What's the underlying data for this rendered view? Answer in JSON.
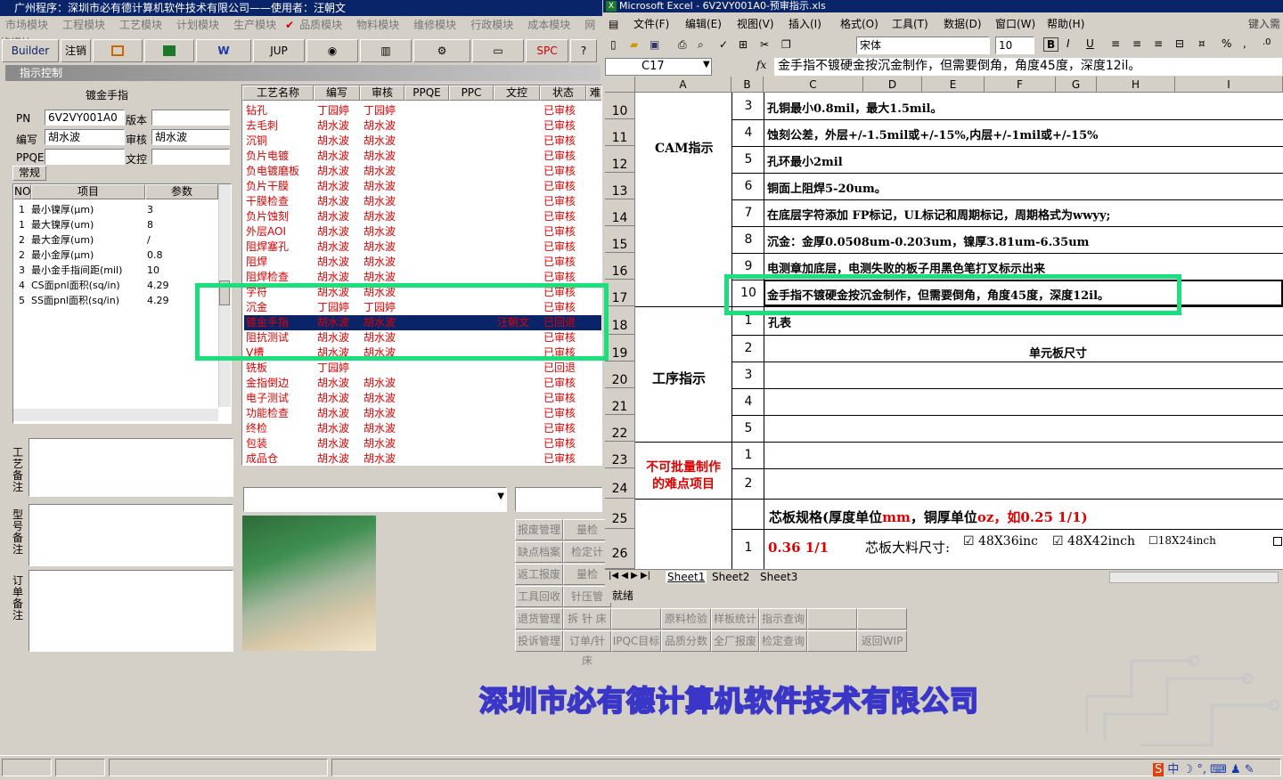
{
  "left_app": {
    "title": "广州程序：深圳市必有德计算机软件技术有限公司——使用者：汪朝文",
    "menu": [
      "市场模块",
      "工程模块",
      "工艺模块",
      "计划模块",
      "生产模块",
      "品质模块",
      "物料模块",
      "维修模块",
      "行政模块",
      "成本模块",
      "网络模块"
    ],
    "toolbar": [
      "Builder",
      "注销",
      "",
      "",
      "",
      "JUP",
      "",
      "",
      "",
      "",
      "SPC",
      ""
    ],
    "panel_title": "指示控制",
    "section": "镀金手指",
    "pn_label": "PN",
    "pn_value": "6V2VY001A0",
    "version_label": "版本",
    "version_value": "",
    "editor_label": "编写",
    "editor_value": "胡水波",
    "reviewer_label": "审核",
    "reviewer_value": "胡水波",
    "ppqe_label": "PPQE",
    "ppqe_value": "",
    "wenkong_label": "文控",
    "wenkong_value": "",
    "tab": "常规",
    "param_headers": [
      "NO",
      "项目",
      "参数"
    ],
    "params": [
      {
        "no": "1",
        "item": "最小镍厚(μm)",
        "val": "3"
      },
      {
        "no": "1",
        "item": "最大镍厚(um)",
        "val": "8"
      },
      {
        "no": "2",
        "item": "最大金厚(um)",
        "val": "/"
      },
      {
        "no": "2",
        "item": "最小金厚(μm)",
        "val": "0.8"
      },
      {
        "no": "3",
        "item": "最小金手指间距(mil)",
        "val": "10"
      },
      {
        "no": "4",
        "item": "CS面pnl面积(sq/in)",
        "val": "4.29"
      },
      {
        "no": "5",
        "item": "SS面pnl面积(sq/in)",
        "val": "4.29"
      }
    ],
    "process_headers": [
      "工艺名称",
      "编写",
      "审核",
      "PPQE",
      "PPC",
      "文控",
      "状态",
      "难"
    ],
    "processes": [
      {
        "name": "钻孔",
        "w": "丁园婷",
        "r": "丁园婷",
        "wk": "",
        "s": "已审核"
      },
      {
        "name": "去毛刺",
        "w": "胡水波",
        "r": "胡水波",
        "wk": "",
        "s": "已审核"
      },
      {
        "name": "沉铜",
        "w": "胡水波",
        "r": "胡水波",
        "wk": "",
        "s": "已审核"
      },
      {
        "name": "负片电镀",
        "w": "胡水波",
        "r": "胡水波",
        "wk": "",
        "s": "已审核"
      },
      {
        "name": "负电镀磨板",
        "w": "胡水波",
        "r": "胡水波",
        "wk": "",
        "s": "已审核"
      },
      {
        "name": "负片干膜",
        "w": "胡水波",
        "r": "胡水波",
        "wk": "",
        "s": "已审核"
      },
      {
        "name": "干膜检查",
        "w": "胡水波",
        "r": "胡水波",
        "wk": "",
        "s": "已审核"
      },
      {
        "name": "负片蚀刻",
        "w": "胡水波",
        "r": "胡水波",
        "wk": "",
        "s": "已审核"
      },
      {
        "name": "外层AOI",
        "w": "胡水波",
        "r": "胡水波",
        "wk": "",
        "s": "已审核"
      },
      {
        "name": "阻焊塞孔",
        "w": "胡水波",
        "r": "胡水波",
        "wk": "",
        "s": "已审核"
      },
      {
        "name": "阻焊",
        "w": "胡水波",
        "r": "胡水波",
        "wk": "",
        "s": "已审核"
      },
      {
        "name": "阻焊检查",
        "w": "胡水波",
        "r": "胡水波",
        "wk": "",
        "s": "已审核"
      },
      {
        "name": "字符",
        "w": "胡水波",
        "r": "胡水波",
        "wk": "",
        "s": "已审核"
      },
      {
        "name": "沉金",
        "w": "丁园婷",
        "r": "丁园婷",
        "wk": "",
        "s": "已审核"
      },
      {
        "name": "镀金手指",
        "w": "胡水波",
        "r": "胡水波",
        "wk": "汪朝文",
        "s": "已回退"
      },
      {
        "name": "阻抗测试",
        "w": "胡水波",
        "r": "胡水波",
        "wk": "",
        "s": "已审核"
      },
      {
        "name": "V槽",
        "w": "胡水波",
        "r": "胡水波",
        "wk": "",
        "s": "已审核"
      },
      {
        "name": "铣板",
        "w": "丁园婷",
        "r": "",
        "wk": "",
        "s": "已回退"
      },
      {
        "name": "金指倒边",
        "w": "胡水波",
        "r": "胡水波",
        "wk": "",
        "s": "已审核"
      },
      {
        "name": "电子测试",
        "w": "胡水波",
        "r": "胡水波",
        "wk": "",
        "s": "已审核"
      },
      {
        "name": "功能检查",
        "w": "胡水波",
        "r": "胡水波",
        "wk": "",
        "s": "已审核"
      },
      {
        "name": "终检",
        "w": "胡水波",
        "r": "胡水波",
        "wk": "",
        "s": "已审核"
      },
      {
        "name": "包装",
        "w": "胡水波",
        "r": "胡水波",
        "wk": "",
        "s": "已审核"
      },
      {
        "name": "成品仓",
        "w": "胡水波",
        "r": "胡水波",
        "wk": "",
        "s": "已审核"
      }
    ],
    "side_labels": [
      "工艺备注",
      "型号备注",
      "订单备注"
    ],
    "buttons_col1": [
      "报废管理",
      "缺点档案",
      "返工报废",
      "工具回收",
      "退货管理",
      "投诉管理"
    ],
    "buttons_col2": [
      "量检",
      "检定计",
      "量检",
      "针压管",
      "拆 针 床",
      "订单/针床"
    ],
    "buttons_row": [
      "IPQC目标",
      "品质分数",
      "全厂报废",
      "检定查询",
      "",
      "返回WIP"
    ],
    "buttons_row_top": [
      "",
      "原料检验",
      "样板统计",
      "指示查询",
      ""
    ]
  },
  "excel": {
    "title": "Microsoft Excel - 6V2VY001A0-预审指示.xls",
    "menu": [
      "文件(F)",
      "编辑(E)",
      "视图(V)",
      "插入(I)",
      "格式(O)",
      "工具(T)",
      "数据(D)",
      "窗口(W)",
      "帮助(H)"
    ],
    "help_hint": "键入需",
    "font": "宋体",
    "size": "10",
    "cell_ref": "C17",
    "formula": "金手指不镀硬金按沉金制作，但需要倒角，角度45度，深度12il。",
    "columns": [
      "A",
      "B",
      "C",
      "D",
      "E",
      "F",
      "G",
      "H",
      "I"
    ],
    "rows": [
      "10",
      "11",
      "12",
      "13",
      "14",
      "15",
      "16",
      "17",
      "18",
      "19",
      "20",
      "21",
      "22",
      "23",
      "24",
      "25",
      "26"
    ],
    "group_cam": "CAM指示",
    "group_proc": "工序指示",
    "group_hard_l1": "不可批量制作",
    "group_hard_l2": "的难点项目",
    "cam_items": [
      {
        "n": "3",
        "t": "孔铜最小0.8mil，最大1.5mil。"
      },
      {
        "n": "4",
        "t": "蚀刻公差，外层+/-1.5mil或+/-15%,内层+/-1mil或+/-15%"
      },
      {
        "n": "5",
        "t": "孔环最小2mil"
      },
      {
        "n": "6",
        "t": "铜面上阻焊5-20um。"
      },
      {
        "n": "7",
        "t": "在底层字符添加 FP标记，UL标记和周期标记，周期格式为wwyy;"
      },
      {
        "n": "8",
        "t": "沉金：金厚0.0508um-0.203um，镍厚3.81um-6.35um"
      },
      {
        "n": "9",
        "t": "电测章加底层，电测失败的板子用黑色笔打叉标示出来"
      },
      {
        "n": "10",
        "t": "金手指不镀硬金按沉金制作，但需要倒角，角度45度，深度12il。"
      }
    ],
    "proc_items": [
      "1",
      "2",
      "3",
      "4",
      "5"
    ],
    "proc_1": "孔表",
    "proc_2": "单元板尺寸",
    "hard_items": [
      "1",
      "2"
    ],
    "core_spec_a": "芯板规格(厚度单位",
    "core_spec_b": "mm",
    "core_spec_c": "，铜厚单位",
    "core_spec_d": "oz",
    "core_spec_e": "，如0.25 1/1)",
    "r26_n": "1",
    "r26_val": "0.36 1/1",
    "r26_lbl": "芯板大料尺寸:",
    "opt1": "48X36inc",
    "opt2": "48X42inch",
    "opt3": "18X24inch",
    "sheets": [
      "Sheet1",
      "Sheet2",
      "Sheet3"
    ],
    "status": "就绪"
  },
  "company": "深圳市必有德计算机软件技术有限公司"
}
